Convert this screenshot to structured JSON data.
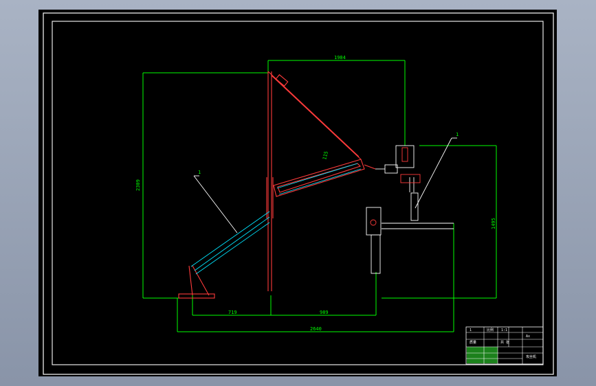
{
  "drawing": {
    "dims": {
      "top_width": "1984",
      "left_height": "2309",
      "right_height": "1495",
      "arm_length": "115",
      "bottom_left": "719",
      "bottom_right": "989",
      "bottom_total": "2640"
    },
    "callouts": {
      "left": "1",
      "right": "1"
    },
    "title_block": {
      "cell_a": "1",
      "cell_b": "比例",
      "cell_c": "1:1",
      "cell_d": "Ax",
      "cell_e": "质量",
      "cell_f": "共 张",
      "title": "攻丝机"
    }
  },
  "colors": {
    "background": "#000000",
    "frame": "#ffffff",
    "dimension": "#00ff00",
    "part_red": "#ff3b3b",
    "part_cyan": "#00e5ff",
    "title_block_line": "#ffffff"
  }
}
